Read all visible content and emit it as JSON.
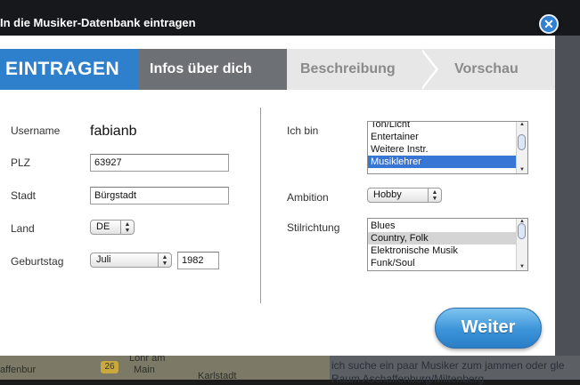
{
  "dialog": {
    "title": "In die Musiker-Datenbank eintragen",
    "close_icon": "close-icon"
  },
  "steps": [
    {
      "label": "EINTRAGEN"
    },
    {
      "label": "Infos über dich"
    },
    {
      "label": "Beschreibung"
    },
    {
      "label": "Vorschau"
    }
  ],
  "form": {
    "username_label": "Username",
    "username_value": "fabianb",
    "plz_label": "PLZ",
    "plz_value": "63927",
    "stadt_label": "Stadt",
    "stadt_value": "Bürgstadt",
    "land_label": "Land",
    "land_value": "DE",
    "geburtstag_label": "Geburtstag",
    "month_value": "Juli",
    "year_value": "1982",
    "ich_bin_label": "Ich bin",
    "ich_bin_options": [
      "Ton/Licht",
      "Entertainer",
      "Weitere Instr.",
      "Musiklehrer"
    ],
    "ich_bin_selected": "Musiklehrer",
    "ambition_label": "Ambition",
    "ambition_value": "Hobby",
    "stil_label": "Stilrichtung",
    "stil_options": [
      "Blues",
      "Country, Folk",
      "Elektronische Musik",
      "Funk/Soul"
    ],
    "stil_selected": "Country, Folk"
  },
  "weiter_label": "Weiter",
  "background": {
    "map_badge": "26",
    "map_labels": [
      "Lohr am",
      "Main",
      "Karlstadt",
      "affenbur"
    ],
    "text_line1": "ich suche ein paar Musiker zum jammen oder gle",
    "text_line2": "Raum Aschaffenburg/Miltenberg"
  },
  "colors": {
    "accent": "#2f80cc",
    "active_step": "#6d7075",
    "selection": "#3876d6"
  }
}
